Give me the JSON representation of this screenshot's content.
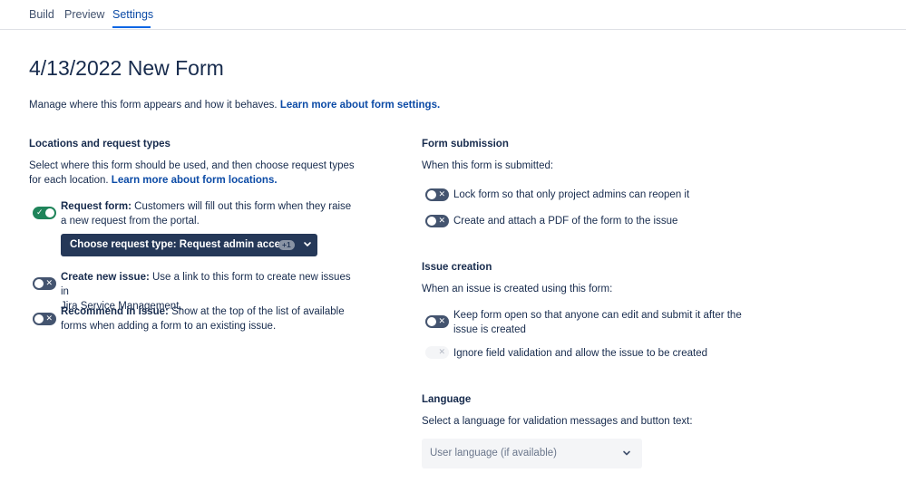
{
  "tabs": [
    {
      "label": "Build"
    },
    {
      "label": "Preview"
    },
    {
      "label": "Settings"
    }
  ],
  "page_title": "4/13/2022 New Form",
  "intro": {
    "text": "Manage where this form appears and how it behaves.",
    "link": "Learn more about form settings."
  },
  "locations": {
    "heading": "Locations and request types",
    "description_line1": "Select where this form should be used, and then choose request types",
    "description_line2": "for each location.",
    "link": "Learn more about form locations.",
    "options": [
      {
        "title": "Request form:",
        "line1": "Customers will fill out this form when they raise",
        "line2": "a new request from the portal.",
        "enabled": true
      },
      {
        "title": "Create new issue:",
        "line1": "Use a link to this form to create new issues in",
        "line2": "Jira Service Management.",
        "enabled": false
      },
      {
        "title": "Recommend in issue:",
        "line1": "Show at the top of the list of available",
        "line2": "forms when adding a form to an existing issue.",
        "enabled": false
      }
    ],
    "request_button": {
      "label": "Choose request type: Request admin access",
      "badge": "+1"
    }
  },
  "form_submission": {
    "heading": "Form submission",
    "description": "When this form is submitted:",
    "options": [
      {
        "label": "Lock form so that only project admins can reopen it",
        "enabled": false
      },
      {
        "label": "Create and attach a PDF of the form to the issue",
        "enabled": false
      }
    ]
  },
  "issue_creation": {
    "heading": "Issue creation",
    "description": "When an issue is created using this form:",
    "options": [
      {
        "line1": "Keep form open so that anyone can edit and submit it after the",
        "line2": "issue is created",
        "enabled": false
      },
      {
        "line1": "Ignore field validation and allow the issue to be created",
        "enabled": false,
        "disabled": true
      }
    ]
  },
  "language": {
    "heading": "Language",
    "description": "Select a language for validation messages and button text:",
    "select_value": "User language (if available)"
  },
  "colors": {
    "accent": "#0c66e4",
    "toggle_on": "#1f845a",
    "toggle_off": "#44546f",
    "button_dark": "#253858"
  }
}
